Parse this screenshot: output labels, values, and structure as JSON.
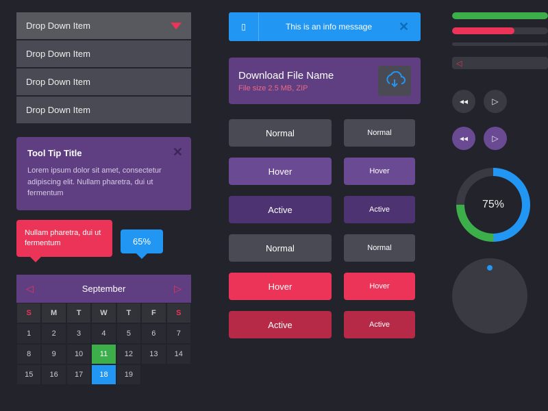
{
  "dropdown": {
    "items": [
      "Drop Down Item",
      "Drop Down Item",
      "Drop Down Item",
      "Drop Down Item"
    ]
  },
  "tooltip": {
    "title": "Tool Tip Title",
    "body": "Lorem ipsum dolor sit amet, consectetur adipiscing elit. Nullam pharetra, dui ut fermentum"
  },
  "pink_tip": "Nullam pharetra, dui ut fermentum",
  "blue_tip": "65%",
  "calendar": {
    "month": "September",
    "dow": [
      "S",
      "M",
      "T",
      "W",
      "T",
      "F",
      "S"
    ],
    "days": [
      1,
      2,
      3,
      4,
      5,
      6,
      7,
      8,
      9,
      10,
      11,
      12,
      13,
      14,
      15,
      16,
      17,
      18,
      19
    ],
    "green": 11,
    "blue": 18
  },
  "info": {
    "msg": "This is an info message"
  },
  "download": {
    "title": "Download File Name",
    "sub": "File size  2.5 MB, ZIP"
  },
  "buttons": {
    "set1": [
      "Normal",
      "Hover",
      "Active"
    ],
    "set2": [
      "Normal",
      "Hover",
      "Active"
    ]
  },
  "bars": {
    "green": 100,
    "pink": 65
  },
  "donut": {
    "label": "75%",
    "value": 75
  },
  "colors": {
    "purple": "#5f3f82",
    "pink": "#ec3458",
    "blue": "#2196f3",
    "green": "#3caf4a"
  }
}
